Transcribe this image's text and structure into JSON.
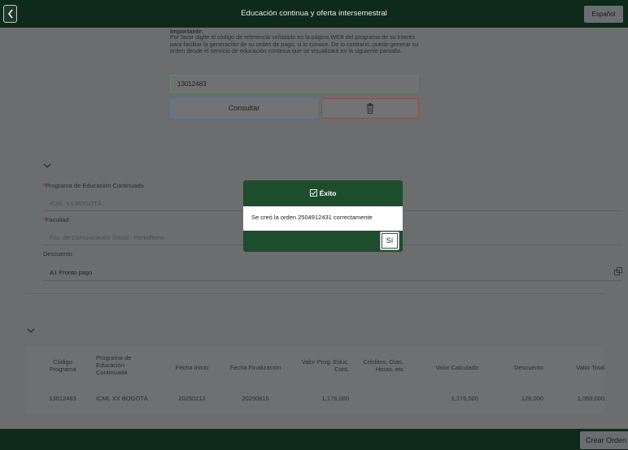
{
  "header": {
    "title": "Educación continua y oferta intersemestral",
    "language_button": "Español"
  },
  "notice": {
    "heading": "Importante:",
    "body": "Por favor digite el código de referencia señalado en la página WEB del programa de su interés para facilitar la generación de su orden de pago, si lo conoce. De lo contrario, puede generar su orden desde el servicio de educación continua que se visualizará en la siguiente pantalla."
  },
  "search": {
    "reference_value": "13012483",
    "consult_label": "Consultar"
  },
  "form": {
    "programa_label": "Programa de Educación Continuada",
    "programa_value": "ICML XX BOGOTÁ",
    "facultad_label": "Facultad",
    "facultad_value": "Fac. de Comunicación Social - Periodismo",
    "descuento_label": "Descuento",
    "descuento_value": "A1 Pronto pago",
    "required_mark": "*"
  },
  "table": {
    "headers": [
      "Código Programa",
      "Programa de Educación Continuada",
      "Fecha Inicio",
      "Fecha Finalización",
      "Valor Prog. Educ. Cont.",
      "Créditos, Días, Horas, etc",
      "Valor Calculado",
      "Descuento",
      "Valor Total"
    ],
    "rows": [
      {
        "codigo": "13012483",
        "programa": "ICML XX BOGOTÁ",
        "fecha_inicio": "20250212",
        "fecha_fin": "20250615",
        "valor_prog": "1,176,000",
        "creditos": "",
        "valor_calculado": "1,176,000",
        "descuento": "126,000",
        "valor_total": "1,050,000"
      }
    ]
  },
  "dialog": {
    "title": "Éxito",
    "message": "Se creó la orden 2504912431 correctamente",
    "yes_label": "Sí"
  },
  "footer": {
    "create_button": "Crear Orden"
  },
  "colors": {
    "header_bg": "#0d2a1a",
    "dialog_bg": "#1e4d2e",
    "overlay_bg": "#6b6d6e"
  }
}
